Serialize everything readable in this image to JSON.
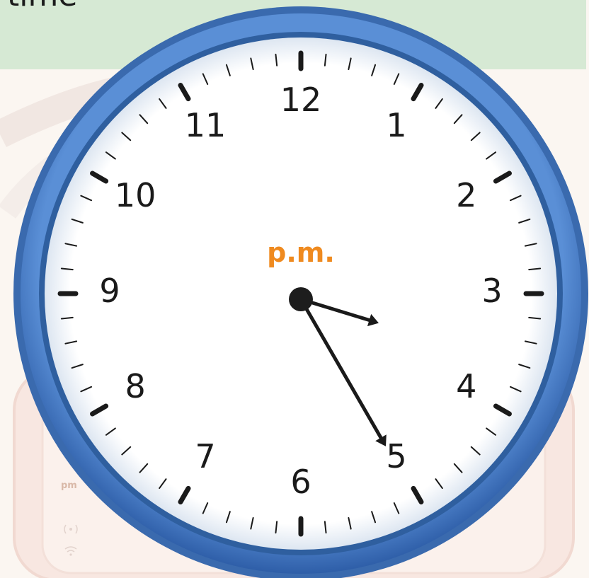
{
  "header": {
    "text": "time",
    "background_color": "#d6e9d4"
  },
  "background": {
    "device_label": "pm",
    "device_color": "#f4d6cf",
    "icons": [
      "radio-waves-icon",
      "wifi-icon"
    ]
  },
  "clock": {
    "period": "p.m.",
    "period_color": "#ef8a1f",
    "rim_color": "#3f6fb6",
    "face_color": "#ffffff",
    "hand_color": "#1a1a1a",
    "hour_hand_angle_deg": 107,
    "minute_hand_angle_deg": 150,
    "numerals": [
      "12",
      "1",
      "2",
      "3",
      "4",
      "5",
      "6",
      "7",
      "8",
      "9",
      "10",
      "11"
    ]
  }
}
